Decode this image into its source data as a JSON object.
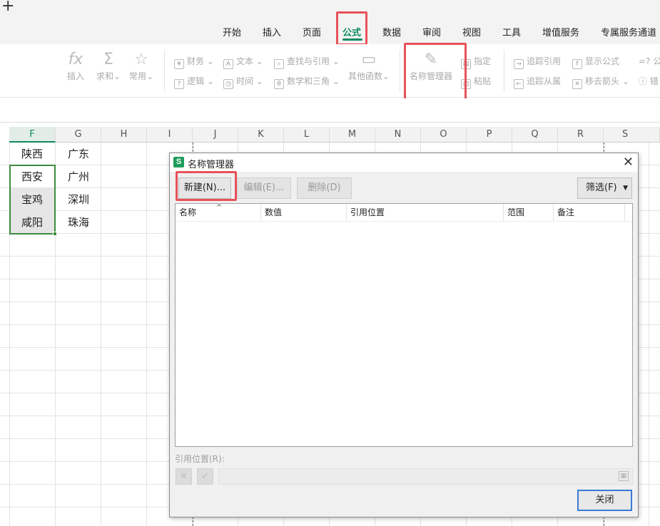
{
  "ribbon_tabs": [
    "开始",
    "插入",
    "页面",
    "公式",
    "数据",
    "审阅",
    "视图",
    "工具",
    "增值服务",
    "专属服务通道"
  ],
  "active_tab": "公式",
  "ribbon": {
    "insert": "插入",
    "sum": "求和",
    "common": "常用",
    "finance": "财务",
    "logic": "逻辑",
    "text": "文本",
    "time": "时间",
    "lookup": "查找与引用",
    "math": "数学和三角",
    "other": "其他函数",
    "name_manager": "名称管理器",
    "assign": "指定",
    "paste": "粘贴",
    "trace_precedents": "追踪引用",
    "trace_dependents": "追踪从属",
    "show_formulas": "显示公式",
    "remove_arrows": "移去箭头",
    "cut_a": "=? 公",
    "cut_b": "错"
  },
  "columns": [
    "F",
    "G",
    "H",
    "I",
    "J",
    "K",
    "L",
    "M",
    "N",
    "O",
    "P",
    "Q",
    "R",
    "S"
  ],
  "cells": {
    "F1": "陕西",
    "G1": "广东",
    "F2": "西安",
    "G2": "广州",
    "F3": "宝鸡",
    "G3": "深圳",
    "F4": "咸阳",
    "G4": "珠海"
  },
  "dialog": {
    "title": "名称管理器",
    "logo": "S",
    "close": "✕",
    "new_btn": "新建(N)...",
    "edit_btn": "编辑(E)...",
    "delete_btn": "删除(D)",
    "filter_btn": "筛选(F)",
    "columns": [
      "名称",
      "数值",
      "引用位置",
      "范围",
      "备注"
    ],
    "ref_label": "引用位置(R):",
    "cancel_icon": "✕",
    "confirm_icon": "✓",
    "close_btn": "关闭"
  },
  "colors": {
    "accent": "#0f8a5f",
    "highlight": "#e8525a",
    "selection": "#3d8b3d",
    "primary_btn_border": "#3a7bd5"
  }
}
